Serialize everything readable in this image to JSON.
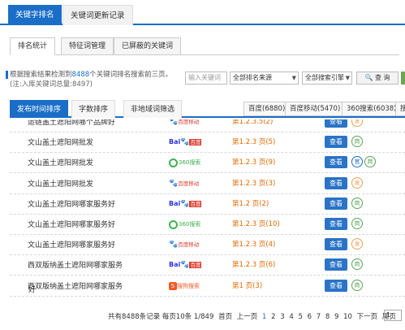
{
  "top_tabs": [
    "关键字排名",
    "关键词更新记录"
  ],
  "sub_tabs": [
    "排名统计",
    "特征词管理",
    "已屏蔽的关键词"
  ],
  "info": {
    "prefix": "根据搜索结果检测到",
    "count": "8488",
    "suffix": "个关键词排名搜索前三页。",
    "note": "(注:入库关键词总量:8497)"
  },
  "filters": {
    "keyword_placeholder": "输入关键词",
    "source": "全部排名来源",
    "engine": "全部搜索引擎",
    "search_label": "查 询"
  },
  "sort_tabs": [
    "发布时间排序",
    "字数排序",
    "非地域词筛选"
  ],
  "engine_tabs": [
    "百度(6880)",
    "百度移动(5470)",
    "360搜索(6038)",
    "搜"
  ],
  "rows": [
    {
      "kw": "运链盖土遮阳网哪个品牌好",
      "engine": "mobile",
      "engine_label": "百度移动",
      "rank": "第1.2.3.5(2)",
      "tags": [
        "发"
      ]
    },
    {
      "kw": "文山盖土遮阳网批发",
      "engine": "baidu",
      "engine_label": "百度",
      "rank": "第1.2.3 页(5)",
      "tags": [
        "商"
      ]
    },
    {
      "kw": "文山盖土遮阳网批发",
      "engine": "360",
      "engine_label": "360搜索",
      "rank": "第1.2.3 页(9)",
      "tags": [
        "官",
        "商"
      ]
    },
    {
      "kw": "文山盖土遮阳网批发",
      "engine": "mobile",
      "engine_label": "百度移动",
      "rank": "第1.2.3 页(3)",
      "tags": [
        "发"
      ]
    },
    {
      "kw": "文山盖土遮阳网哪家服务好",
      "engine": "baidu",
      "engine_label": "百度",
      "rank": "第1.2 页(2)",
      "tags": [
        "商"
      ]
    },
    {
      "kw": "文山盖土遮阳网哪家服务好",
      "engine": "360",
      "engine_label": "360搜索",
      "rank": "第1.2.3 页(10)",
      "tags": [
        "商"
      ]
    },
    {
      "kw": "文山盖土遮阳网哪家服务好",
      "engine": "mobile",
      "engine_label": "百度移动",
      "rank": "第1.2.3 页(4)",
      "tags": [
        "发"
      ]
    },
    {
      "kw": "西双版纳盖土遮阳网哪家服务",
      "engine": "baidu",
      "engine_label": "百度",
      "rank": "第1.2.3 页(6)",
      "tags": [
        "商"
      ]
    },
    {
      "kw": "西双版纳盖土遮阳网哪家服务",
      "engine": "sogou",
      "engine_label": "搜狗搜索",
      "rank": "第1 页(3)",
      "tags": [
        "商"
      ]
    }
  ],
  "overflow_char": "好",
  "view_label": "查看",
  "pager": {
    "summary": "共有8488条记录 每页10条 1/849",
    "first": "首页",
    "prev": "上一页",
    "pages": [
      "1",
      "2",
      "3",
      "4",
      "5",
      "6",
      "7",
      "8",
      "9",
      "10"
    ],
    "next": "下一页",
    "last": "尾页",
    "input_value": "1"
  },
  "colors": {
    "accent": "#1a6ec8",
    "rank": "#e06900"
  }
}
